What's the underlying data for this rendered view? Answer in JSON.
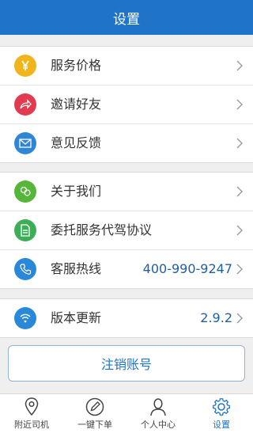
{
  "header": {
    "title": "设置"
  },
  "group1": [
    {
      "label": "服务价格",
      "icon": "yen-icon",
      "color": "#f1b51c"
    },
    {
      "label": "邀请好友",
      "icon": "share-icon",
      "color": "#e23b51"
    },
    {
      "label": "意见反馈",
      "icon": "mail-icon",
      "color": "#2f86d6"
    }
  ],
  "group2": [
    {
      "label": "关于我们",
      "icon": "people-icon",
      "color": "#55b63a"
    },
    {
      "label": "委托服务代驾协议",
      "icon": "document-icon",
      "color": "#3dae58"
    },
    {
      "label": "客服热线",
      "value": "400-990-9247",
      "icon": "phone-icon",
      "color": "#2a88d8"
    }
  ],
  "group3": [
    {
      "label": "版本更新",
      "value": "2.9.2",
      "icon": "wifi-icon",
      "color": "#2a88d8"
    }
  ],
  "logout": {
    "label": "注销账号"
  },
  "tabbar": {
    "items": [
      {
        "label": "附近司机",
        "icon": "location-pin-icon"
      },
      {
        "label": "一键下单",
        "icon": "pen-icon"
      },
      {
        "label": "个人中心",
        "icon": "person-icon"
      },
      {
        "label": "设置",
        "icon": "gear-icon",
        "active": true
      }
    ]
  },
  "colors": {
    "accent": "#1f74c9"
  }
}
